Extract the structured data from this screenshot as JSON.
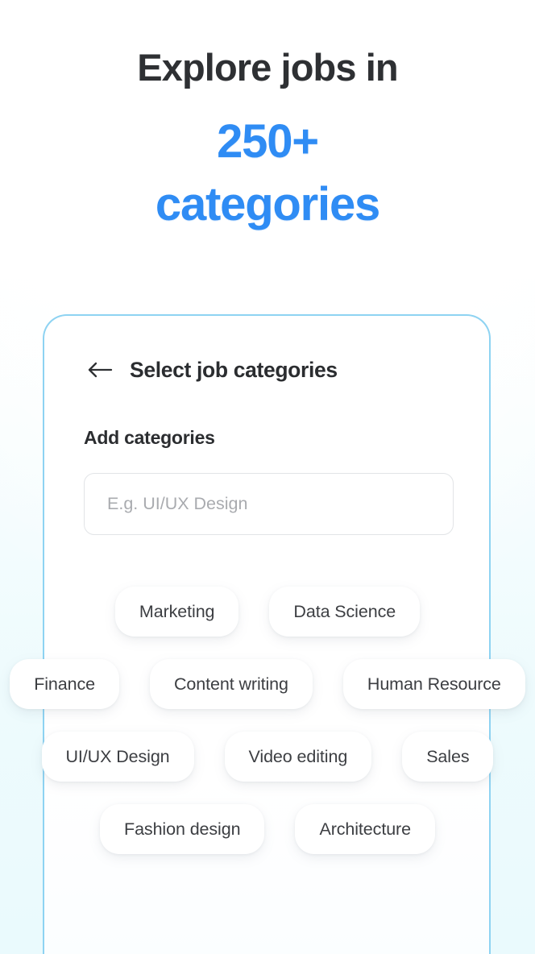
{
  "hero": {
    "line_dark": "Explore jobs in",
    "line_blue_1": "250+",
    "line_blue_2": "categories",
    "accent_color": "#2f8cf4",
    "dark_color": "#2e3033"
  },
  "panel": {
    "border_color": "#8ed3f2",
    "back_icon": "arrow-left-icon",
    "title": "Select job categories",
    "section_label": "Add categories",
    "search": {
      "value": "",
      "placeholder": "E.g. UI/UX Design"
    },
    "chip_rows": [
      [
        "Marketing",
        "Data Science"
      ],
      [
        "Finance",
        "Content writing",
        "Human Resource"
      ],
      [
        "UI/UX Design",
        "Video editing",
        "Sales"
      ],
      [
        "Fashion design",
        "Architecture"
      ]
    ]
  }
}
